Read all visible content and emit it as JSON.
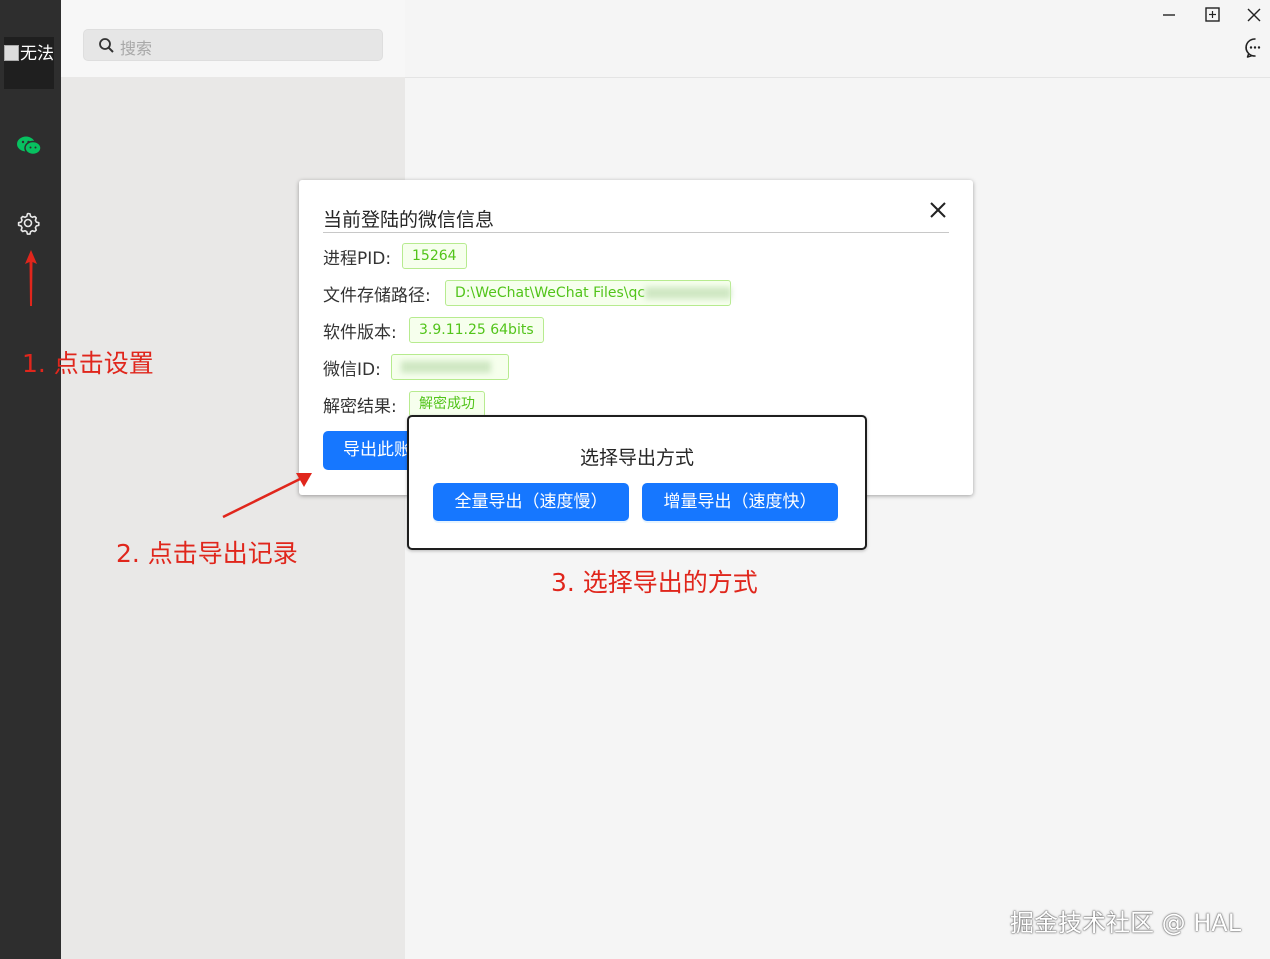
{
  "sidebar": {
    "avatar_alt": "无法",
    "items": [
      {
        "icon": "chat-icon"
      },
      {
        "icon": "gear-icon"
      }
    ]
  },
  "search": {
    "placeholder": "搜索"
  },
  "dialog": {
    "title": "当前登陆的微信信息",
    "rows": [
      {
        "label": "进程PID:",
        "value": "15264"
      },
      {
        "label": "文件存储路径:",
        "value": "D:\\WeChat\\WeChat Files\\qc"
      },
      {
        "label": "软件版本:",
        "value": "3.9.11.25 64bits"
      },
      {
        "label": "微信ID:",
        "value": ""
      },
      {
        "label": "解密结果:",
        "value": "解密成功"
      }
    ],
    "export_button": "导出此账"
  },
  "popup": {
    "title": "选择导出方式",
    "full_button": "全量导出（速度慢）",
    "incremental_button": "增量导出（速度快）"
  },
  "annotations": {
    "step1": "1. 点击设置",
    "step2": "2. 点击导出记录",
    "step3": "3. 选择导出的方式"
  },
  "watermark": "掘金技术社区 @ HAL",
  "colors": {
    "sidebar": "#2e2e2e",
    "primary": "#1677ff",
    "success_text": "#52c41a",
    "annotation": "#e0261c"
  }
}
